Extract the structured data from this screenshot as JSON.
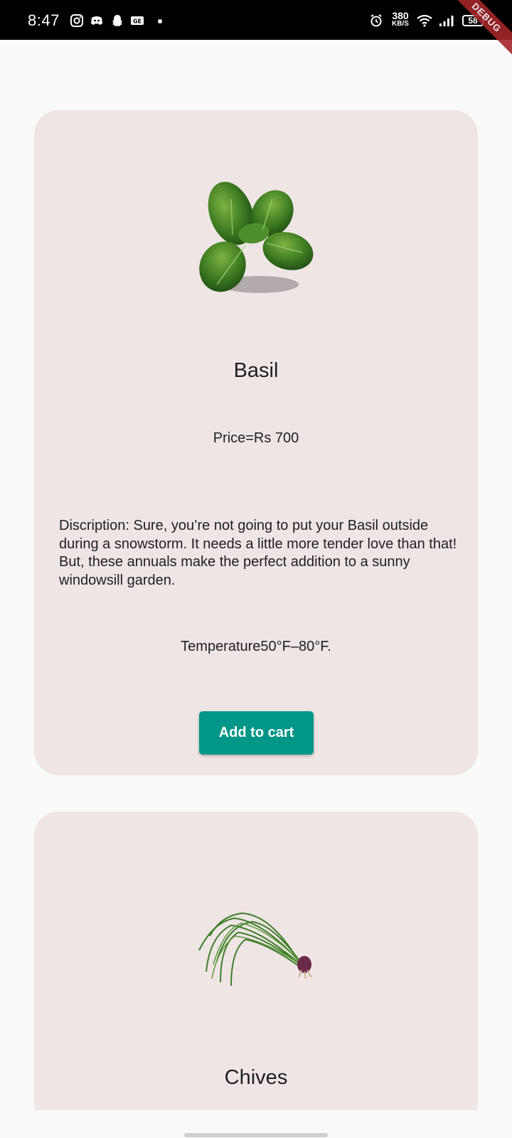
{
  "status_bar": {
    "time": "8:47",
    "net_speed_value": "380",
    "net_speed_unit": "KB/S",
    "battery": "58",
    "icons": [
      "instagram-icon",
      "discord-icon",
      "snapchat-icon",
      "news-icon",
      "alarm-icon",
      "wifi-icon",
      "signal-icon",
      "battery-icon"
    ]
  },
  "debug_banner": "DEBUG",
  "products": [
    {
      "name": "Basil",
      "price": "Price=Rs 700",
      "description": "Discription:  Sure, you’re not going to put your Basil outside during a snowstorm. It needs a little more tender love than that! But, these annuals make the perfect addition to a sunny windowsill garden.",
      "temperature": "Temperature50°F–80°F.",
      "button_label": "Add to cart"
    },
    {
      "name": "Chives"
    }
  ],
  "colors": {
    "card_background": "#efe5e5",
    "button_background": "#009688",
    "page_background": "#fafafa"
  }
}
